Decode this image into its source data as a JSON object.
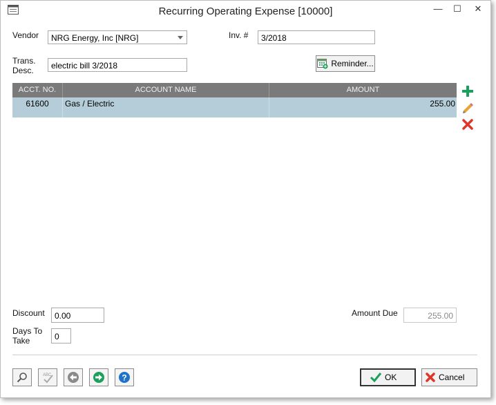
{
  "window": {
    "title": "Recurring Operating Expense [10000]",
    "controls": {
      "minimize": "—",
      "maximize": "☐",
      "close": "✕"
    }
  },
  "form": {
    "vendor_label": "Vendor",
    "vendor_value": "NRG Energy, Inc [NRG]",
    "inv_label": "Inv. #",
    "inv_value": "3/2018",
    "trans_label_line1": "Trans.",
    "trans_label_line2": "Desc.",
    "trans_value": "electric bill 3/2018",
    "reminder_label": "Reminder..."
  },
  "grid": {
    "columns": [
      "ACCT. NO.",
      "ACCOUNT NAME",
      "AMOUNT"
    ],
    "rows": [
      {
        "acct_no": "61600",
        "account_name": "Gas / Electric",
        "amount": "255.00"
      }
    ]
  },
  "side_actions": {
    "add_icon": "plus-icon",
    "edit_icon": "pencil-icon",
    "delete_icon": "x-icon"
  },
  "footer": {
    "discount_label": "Discount",
    "discount_value": "0.00",
    "days_label_line1": "Days To",
    "days_label_line2": "Take",
    "days_value": "0",
    "amount_due_label": "Amount Due",
    "amount_due_value": "255.00"
  },
  "toolbar": {
    "icons": [
      "search-icon",
      "spellcheck-icon",
      "previous-icon",
      "next-icon",
      "help-icon"
    ],
    "ok_label": "OK",
    "cancel_label": "Cancel"
  },
  "colors": {
    "grid_header": "#7a7a7a",
    "grid_row_selected": "#b4cdd8",
    "add_green": "#1aa05a",
    "delete_red": "#e0352b",
    "nav_blue": "#1e73c8"
  }
}
